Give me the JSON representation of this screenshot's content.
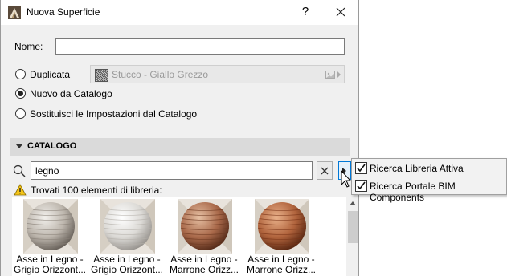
{
  "window": {
    "title": "Nuova Superficie",
    "help_label": "?"
  },
  "form": {
    "name_label": "Nome:",
    "name_value": "",
    "options": [
      {
        "label": "Duplicata",
        "selected": false
      },
      {
        "label": "Nuovo da Catalogo",
        "selected": true
      },
      {
        "label": "Sostituisci le Impostazioni dal Catalogo",
        "selected": false
      }
    ],
    "duplicate_source": "Stucco - Giallo Grezzo"
  },
  "catalog": {
    "section_label": "CATALOGO",
    "search_value": "legno",
    "found_text": "Trovati 100 elementi di libreria:",
    "items": [
      {
        "line1": "Asse in Legno -",
        "line2": "Grigio Orizzont...",
        "colors": [
          "#f2f0ec",
          "#bdb6ad",
          "#5c554e"
        ],
        "stripe": "#8a8279"
      },
      {
        "line1": "Asse in Legno -",
        "line2": "Grigio Orizzont...",
        "colors": [
          "#ffffff",
          "#dcdad6",
          "#8e8a85"
        ],
        "stripe": "#b5b1ab"
      },
      {
        "line1": "Asse in Legno -",
        "line2": "Marrone Orizz...",
        "colors": [
          "#e6c0a3",
          "#a9694a",
          "#4a2313"
        ],
        "stripe": "#6e3a22"
      },
      {
        "line1": "Asse in Legno -",
        "line2": "Marrone Orizz...",
        "colors": [
          "#e9b18a",
          "#b0633c",
          "#4e200d"
        ],
        "stripe": "#7a3519"
      }
    ]
  },
  "popup_menu": {
    "items": [
      {
        "label": "Ricerca Libreria Attiva",
        "checked": true
      },
      {
        "label": "Ricerca Portale BIM Components",
        "checked": true
      }
    ]
  }
}
